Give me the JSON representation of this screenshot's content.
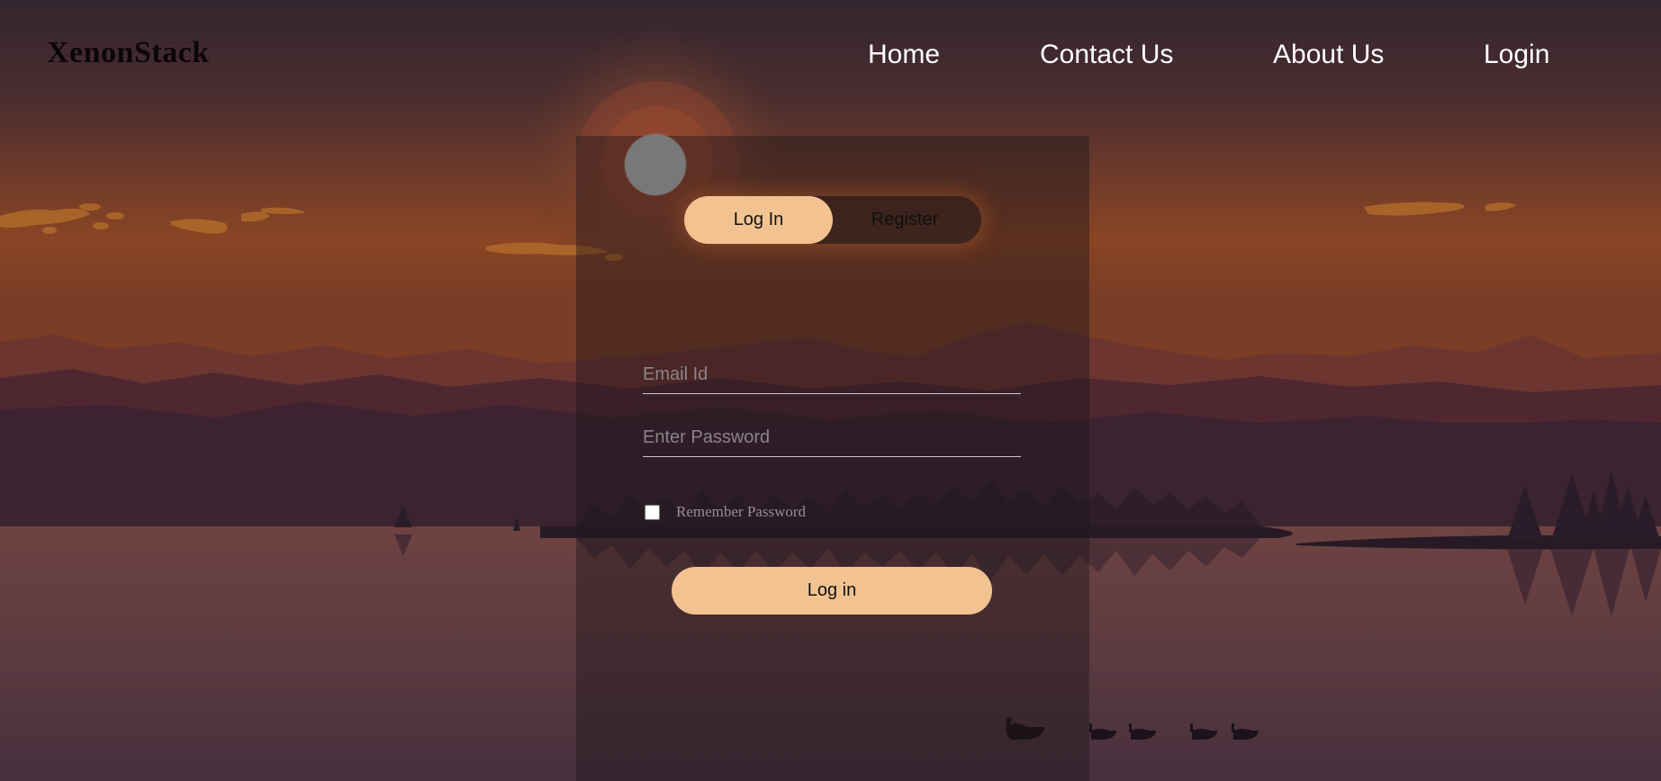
{
  "brand": {
    "name": "XenonStack"
  },
  "nav": {
    "home": "Home",
    "contact": "Contact Us",
    "about": "About Us",
    "login": "Login"
  },
  "auth": {
    "tab_login": "Log In",
    "tab_register": "Register",
    "active_tab": "Log In",
    "email_placeholder": "Email Id",
    "password_placeholder": "Enter Password",
    "remember_label": "Remember Password",
    "remember_checked": false,
    "submit_label": "Log in"
  },
  "colors": {
    "accent": "#f2c391",
    "sky_top": "#3a2a38",
    "sky_glow": "#8a4a24",
    "lake": "#5a3a40"
  }
}
